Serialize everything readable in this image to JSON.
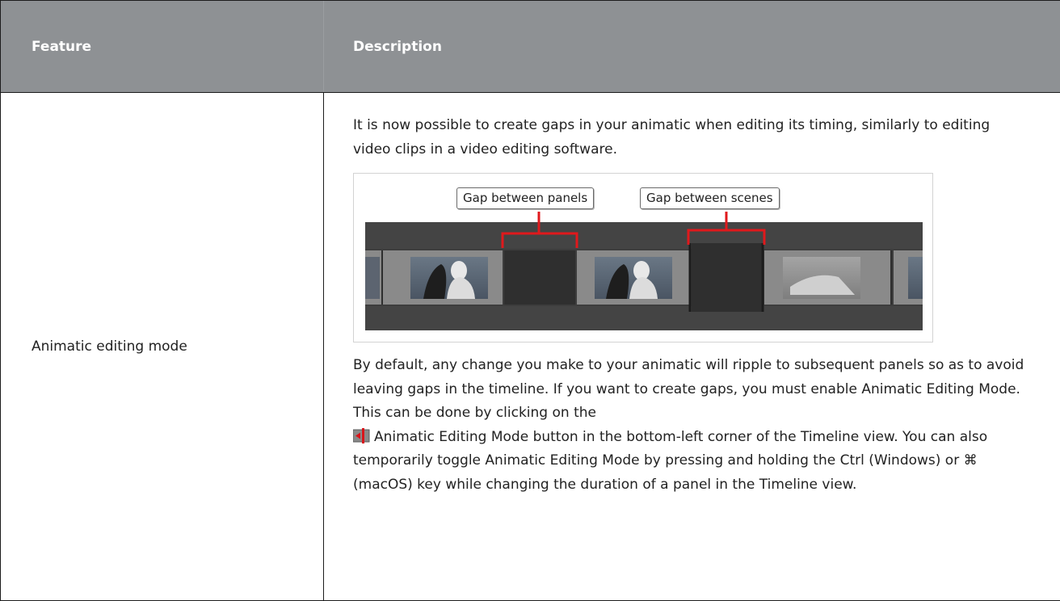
{
  "table": {
    "headers": [
      "Feature",
      "Description"
    ],
    "feature_name": "Animatic editing mode",
    "description_intro": "It is now possible to create gaps in your animatic when editing its timing, similarly to editing video clips in a video editing software.",
    "figure": {
      "callout_panels": "Gap between panels",
      "callout_scenes": "Gap between scenes"
    },
    "description_body_part1": "By default, any change you make to your animatic will ripple to subsequent panels so as to avoid leaving gaps in the timeline. If you want to create gaps, you must enable Animatic Editing Mode. This can be done by clicking on the",
    "button_icon": "animatic-editing-mode-icon",
    "description_body_part2": "Animatic Editing Mode button in the bottom-left corner of the Timeline view. You can also temporarily toggle Animatic Editing Mode by pressing and holding the Ctrl (Windows) or ⌘ (macOS) key while changing the duration of a panel in the Timeline view."
  },
  "colors": {
    "header_bg": "#8e9194",
    "header_text": "#ffffff",
    "gap_marker": "#e0191c",
    "timeline_dark": "#3d3d3d"
  }
}
